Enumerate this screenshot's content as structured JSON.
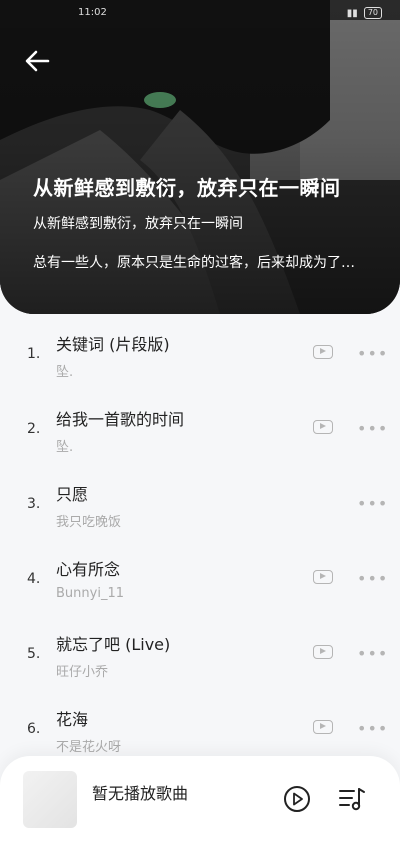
{
  "status": {
    "time": "11:02",
    "battery": "70"
  },
  "header": {
    "title": "从新鲜感到敷衍，放弃只在一瞬间",
    "subtitle": "从新鲜感到敷衍，放弃只在一瞬间",
    "description": "总有一些人，原本只是生命的过客，后来却成为了我们生命中的一部分"
  },
  "songs": [
    {
      "index": "1.",
      "title": "关键词 (片段版)",
      "artist": "坠."
    },
    {
      "index": "2.",
      "title": "给我一首歌的时间",
      "artist": "坠."
    },
    {
      "index": "3.",
      "title": "只愿",
      "artist": "我只吃晚饭"
    },
    {
      "index": "4.",
      "title": "心有所念",
      "artist": "Bunnyi_11"
    },
    {
      "index": "5.",
      "title": "就忘了吧 (Live)",
      "artist": "旺仔小乔"
    },
    {
      "index": "6.",
      "title": "花海",
      "artist": "不是花火呀"
    }
  ],
  "player": {
    "title": "暂无播放歌曲"
  }
}
